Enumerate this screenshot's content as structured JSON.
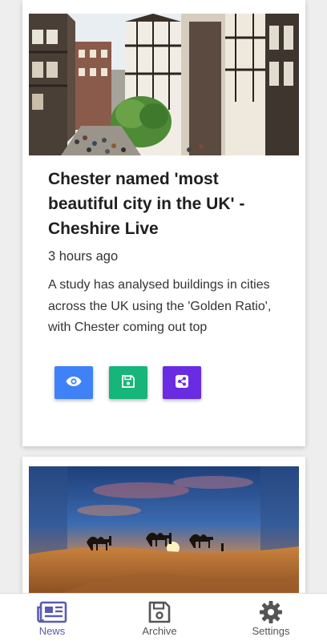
{
  "feed": {
    "articles": [
      {
        "title": "Chester named 'most beautiful city in the UK' - Cheshire Live",
        "time": "3 hours ago",
        "description": "A study has analysed buildings in cities across the UK using the 'Golden Ratio', with Chester coming out top",
        "image": "chester-street-photo",
        "actions": [
          {
            "icon": "eye-icon",
            "color": "#3f82f7"
          },
          {
            "icon": "floppy-disk-icon",
            "color": "#16b57a"
          },
          {
            "icon": "share-icon",
            "color": "#6a2ce3"
          }
        ]
      },
      {
        "image": "desert-camels-sunset-photo"
      }
    ]
  },
  "bottom_nav": {
    "items": [
      {
        "label": "News",
        "icon": "newspaper-icon",
        "active": true,
        "color": "#5b5bb0"
      },
      {
        "label": "Archive",
        "icon": "floppy-disk-icon",
        "active": false,
        "color": "#555555"
      },
      {
        "label": "Settings",
        "icon": "gear-icon",
        "active": false,
        "color": "#555555"
      }
    ]
  }
}
